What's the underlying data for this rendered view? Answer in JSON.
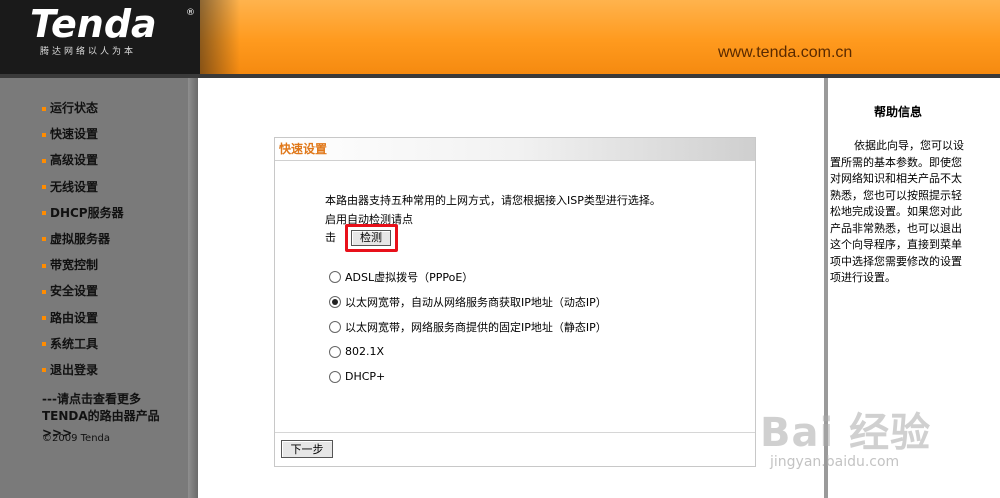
{
  "header": {
    "logo": "Tenda",
    "logo_mark": "®",
    "tagline": "腾达网络以人为本",
    "url": "www.tenda.com.cn"
  },
  "sidebar": {
    "items": [
      {
        "label": "运行状态"
      },
      {
        "label": "快速设置"
      },
      {
        "label": "高级设置"
      },
      {
        "label": "无线设置"
      },
      {
        "label": "DHCP服务器"
      },
      {
        "label": "虚拟服务器"
      },
      {
        "label": "带宽控制"
      },
      {
        "label": "安全设置"
      },
      {
        "label": "路由设置"
      },
      {
        "label": "系统工具"
      },
      {
        "label": "退出登录"
      }
    ],
    "more_line1": "---请点击查看更多",
    "more_line2": "TENDA的路由器产品>>>",
    "copyright": "©2009 Tenda"
  },
  "panel": {
    "title": "快速设置",
    "intro": "本路由器支持五种常用的上网方式，请您根据接入ISP类型进行选择。",
    "detect_line1": "启用自动检测请点",
    "detect_line2_prefix": "击",
    "detect_button": "检测",
    "options": [
      {
        "label": "ADSL虚拟拨号（PPPoE）",
        "checked": false
      },
      {
        "label": "以太网宽带，自动从网络服务商获取IP地址（动态IP）",
        "checked": true
      },
      {
        "label": "以太网宽带，网络服务商提供的固定IP地址（静态IP）",
        "checked": false
      },
      {
        "label": "802.1X",
        "checked": false
      },
      {
        "label": "DHCP+",
        "checked": false
      }
    ],
    "next_button": "下一步"
  },
  "help": {
    "title": "帮助信息",
    "text": "依据此向导，您可以设置所需的基本参数。即使您对网络知识和相关产品不太熟悉，您也可以按照提示轻松地完成设置。如果您对此产品非常熟悉，也可以退出这个向导程序，直接到菜单项中选择您需要修改的设置项进行设置。"
  },
  "watermark": {
    "logo": "Bai 经验",
    "url": "jingyan.baidu.com"
  },
  "colors": {
    "header_orange": "#ff9a1e",
    "sidebar_gray": "#7a7a7a",
    "accent_orange": "#ff8c00",
    "panel_title": "#e0781a",
    "highlight_red": "#e8101a"
  }
}
